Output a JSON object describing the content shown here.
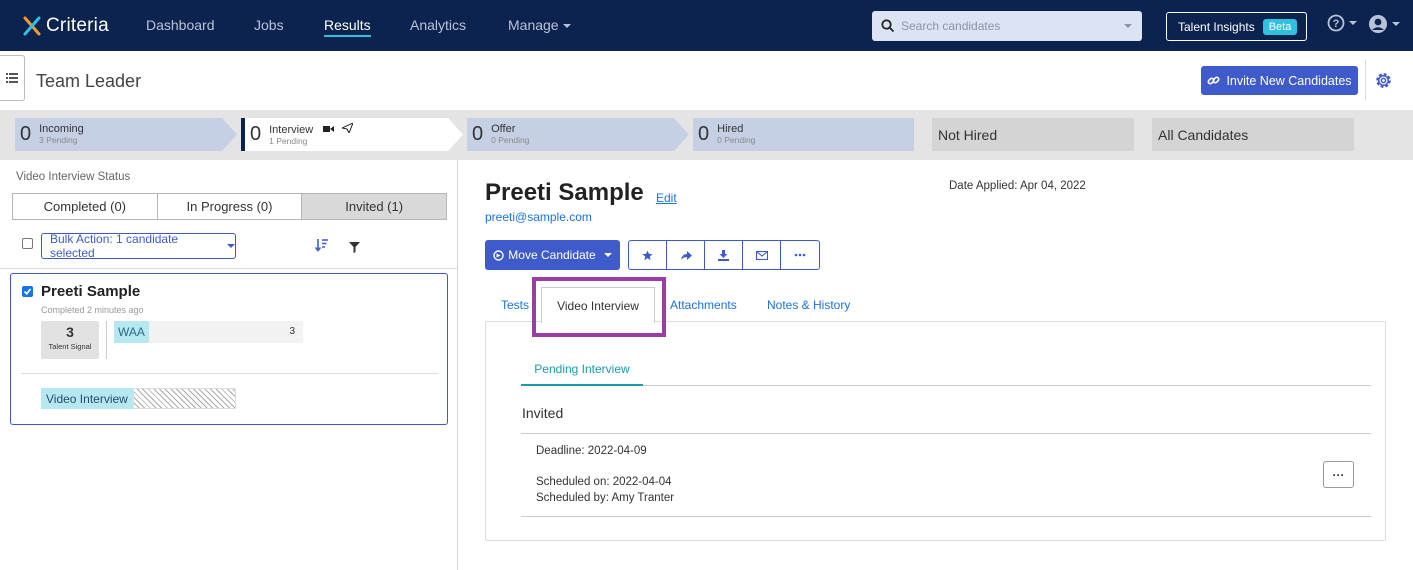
{
  "app": {
    "logo_text": "Criteria"
  },
  "nav": {
    "items": [
      {
        "label": "Dashboard"
      },
      {
        "label": "Jobs"
      },
      {
        "label": "Results"
      },
      {
        "label": "Analytics"
      },
      {
        "label": "Manage"
      }
    ],
    "active": "Results",
    "search_placeholder": "Search candidates",
    "talent_insights_label": "Talent Insights",
    "beta_label": "Beta"
  },
  "header": {
    "job_title": "Team Leader",
    "invite_button": "Invite New Candidates"
  },
  "pipeline": {
    "stages": [
      {
        "count": "0",
        "label": "Incoming",
        "sub": "3 Pending"
      },
      {
        "count": "0",
        "label": "Interview",
        "sub": "1 Pending"
      },
      {
        "count": "0",
        "label": "Offer",
        "sub": "0 Pending"
      },
      {
        "count": "0",
        "label": "Hired",
        "sub": "0 Pending"
      }
    ],
    "not_hired": "Not Hired",
    "all_candidates": "All Candidates"
  },
  "left": {
    "status_label": "Video Interview Status",
    "segments": [
      "Completed (0)",
      "In Progress (0)",
      "Invited (1)"
    ],
    "bulk_action": "Bulk Action: 1 candidate selected",
    "card": {
      "name": "Preeti Sample",
      "sub": "Completed 2 minutes ago",
      "signal_value": "3",
      "signal_label": "Talent Signal",
      "waa_tag": "WAA",
      "waa_value": "3",
      "chip": "Video Interview"
    }
  },
  "detail": {
    "name": "Preeti Sample",
    "edit": "Edit",
    "email": "preeti@sample.com",
    "date_applied": "Date Applied: Apr 04, 2022",
    "move_button": "Move Candidate",
    "tabs": [
      "Tests",
      "Video Interview",
      "Attachments",
      "Notes & History"
    ],
    "subtab": "Pending Interview",
    "status": "Invited",
    "deadline": "Deadline: 2022-04-09",
    "scheduled_on": "Scheduled on: 2022-04-04",
    "scheduled_by": "Scheduled by: Amy Tranter",
    "more": "···"
  },
  "colors": {
    "nav_bg": "#0c2350",
    "accent": "#3f5bc9",
    "highlight": "#9a3ea4",
    "teal": "#2ec1e0"
  }
}
